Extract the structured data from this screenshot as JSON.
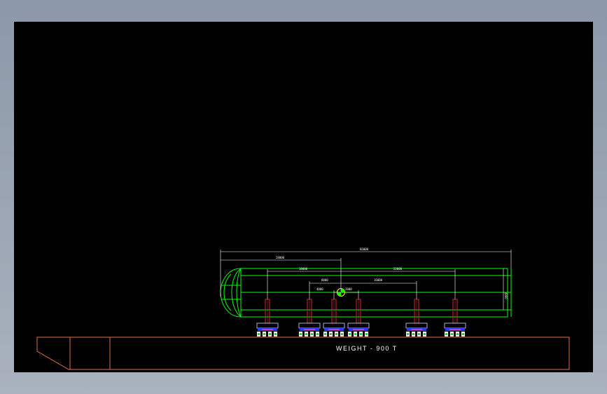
{
  "drawing": {
    "weight_label": "WEIGHT - 900 T",
    "dimensions": {
      "overall": "66000",
      "head_to_cog": "28000",
      "left_span": "18000",
      "right_span": "22000",
      "inner_left": "8000",
      "inner_right_a": "4000",
      "inner_right_b": "2000",
      "outer_right": "16000",
      "vertical": "4800"
    },
    "colors": {
      "background": "#000000",
      "vessel": "#00ff00",
      "dimension": "#ffffff",
      "saddle": "#cc2b2b",
      "barge": "#e26f4a",
      "cog": "#ffff00"
    }
  }
}
